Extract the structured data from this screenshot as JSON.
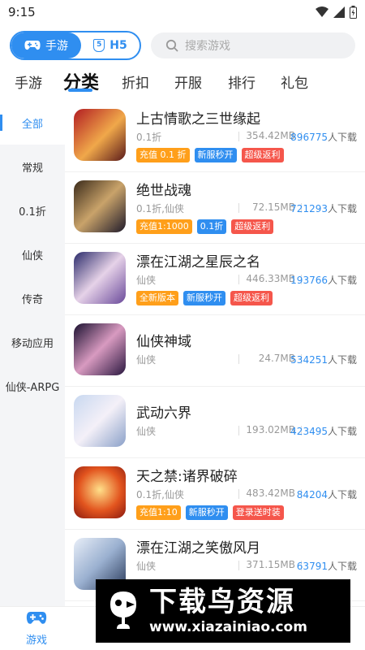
{
  "status_bar": {
    "time": "9:15"
  },
  "mode_toggle": {
    "active_label": "手游",
    "inactive_label": "H5",
    "h5_badge": "5"
  },
  "search": {
    "placeholder": "搜索游戏"
  },
  "category_tabs": [
    "手游",
    "分类",
    "折扣",
    "开服",
    "排行",
    "礼包"
  ],
  "active_category_tab": "分类",
  "sidebar": {
    "items": [
      "全部",
      "常规",
      "0.1折",
      "仙侠",
      "传奇",
      "移动应用",
      "仙侠-ARPG"
    ],
    "active": "全部"
  },
  "games": [
    {
      "name": "上古情歌之三世缘起",
      "category": "0.1折",
      "size": "354.42MB",
      "downloads": "896775",
      "downloads_suffix": "人下载",
      "tags": [
        {
          "text": "充值 0.1 折",
          "color": "orange"
        },
        {
          "text": "新服秒开",
          "color": "blue"
        },
        {
          "text": "超级返利",
          "color": "red"
        }
      ]
    },
    {
      "name": "绝世战魂",
      "category": "0.1折,仙侠",
      "size": "72.15MB",
      "downloads": "721293",
      "downloads_suffix": "人下载",
      "tags": [
        {
          "text": "充值1:1000",
          "color": "orange"
        },
        {
          "text": "0.1折",
          "color": "blue"
        },
        {
          "text": "超级返利",
          "color": "red"
        }
      ]
    },
    {
      "name": "漂在江湖之星辰之名",
      "category": "仙侠",
      "size": "446.33MB",
      "downloads": "193766",
      "downloads_suffix": "人下载",
      "tags": [
        {
          "text": "全新版本",
          "color": "orange"
        },
        {
          "text": "新服秒开",
          "color": "blue"
        },
        {
          "text": "超级返利",
          "color": "red"
        }
      ]
    },
    {
      "name": "仙侠神域",
      "category": "仙侠",
      "size": "24.7MB",
      "downloads": "534251",
      "downloads_suffix": "人下载",
      "tags": []
    },
    {
      "name": "武动六界",
      "category": "仙侠",
      "size": "193.02MB",
      "downloads": "423495",
      "downloads_suffix": "人下载",
      "tags": []
    },
    {
      "name": "天之禁:诸界破碎",
      "category": "0.1折,仙侠",
      "size": "483.42MB",
      "downloads": "84204",
      "downloads_suffix": "人下载",
      "tags": [
        {
          "text": "充值1:10",
          "color": "orange"
        },
        {
          "text": "新服秒开",
          "color": "blue"
        },
        {
          "text": "登录送时装",
          "color": "red"
        }
      ]
    },
    {
      "name": "漂在江湖之笑傲风月",
      "category": "仙侠",
      "size": "371.15MB",
      "downloads": "63791",
      "downloads_suffix": "人下载",
      "tags": []
    }
  ],
  "bottom_nav": {
    "items": [
      "游戏"
    ],
    "active": "游戏"
  },
  "watermark": {
    "title": "下载鸟资源",
    "url": "www.xiazainiao.com"
  },
  "colors": {
    "accent": "#2f8ef0",
    "orange": "#ff9f1a",
    "red": "#f5564b"
  },
  "icons": [
    "wifi-icon",
    "signal-icon",
    "battery-icon",
    "gamepad-icon",
    "search-icon"
  ]
}
